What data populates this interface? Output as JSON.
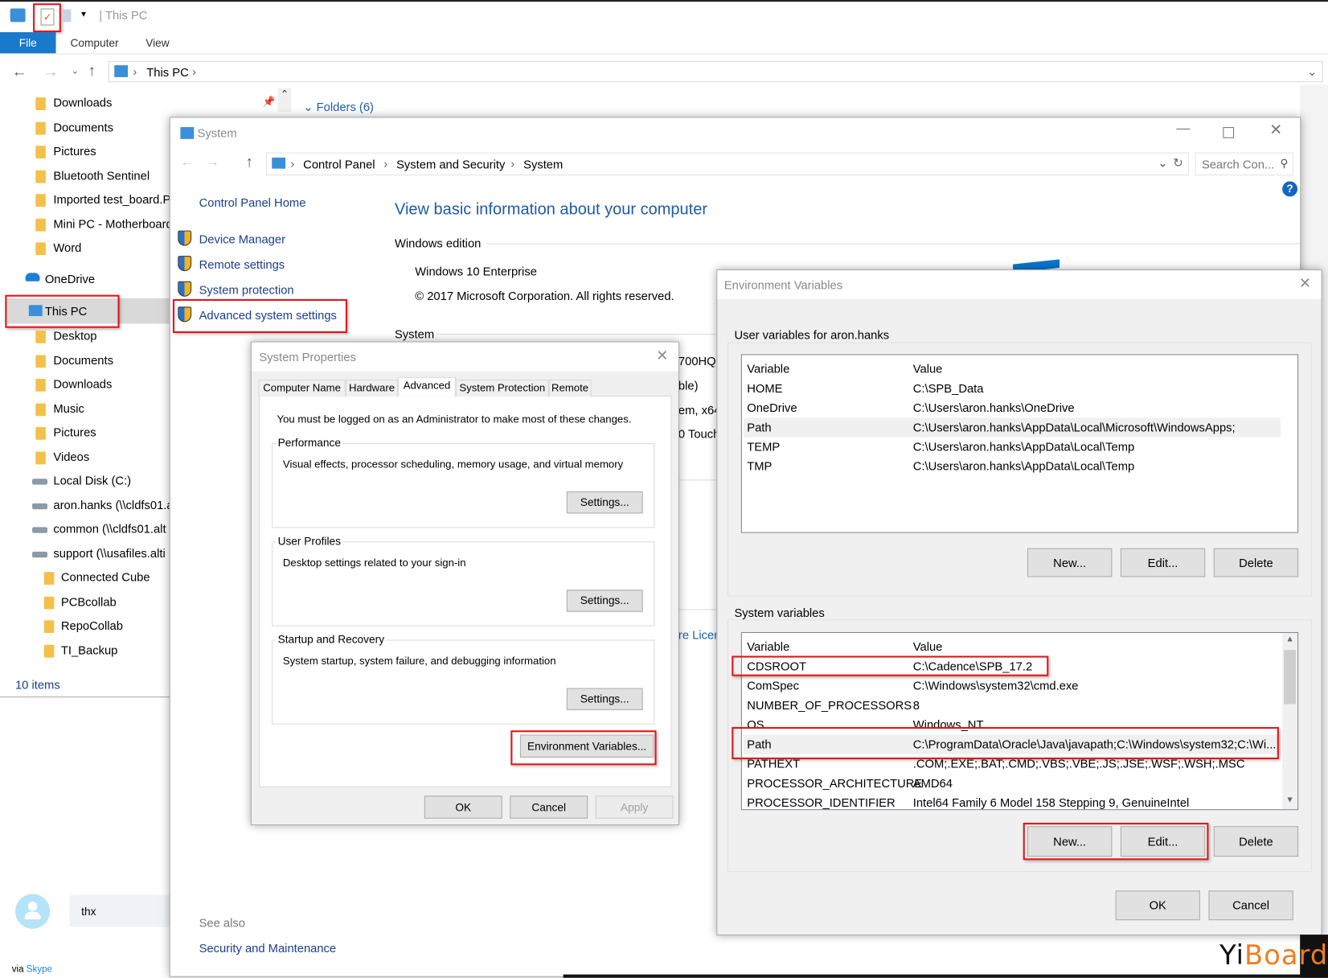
{
  "explorer": {
    "title": "This PC",
    "ribbon_tabs": [
      "File",
      "Computer",
      "View"
    ],
    "address": "This PC",
    "folders_header": "Folders (6)",
    "quick_access": [
      "Downloads",
      "Documents",
      "Pictures",
      "Bluetooth Sentinel",
      "Imported test_board.P",
      "Mini PC - Motherboard",
      "Word"
    ],
    "onedrive": "OneDrive",
    "this_pc": "This PC",
    "this_pc_items": [
      "Desktop",
      "Documents",
      "Downloads",
      "Music",
      "Pictures",
      "Videos",
      "Local Disk (C:)",
      "aron.hanks (\\\\cldfs01.a",
      "common (\\\\cldfs01.alt",
      "support (\\\\usafiles.alti"
    ],
    "network_folders": [
      "Connected Cube",
      "PCBcollab",
      "RepoCollab",
      "TI_Backup"
    ],
    "status": "10 items"
  },
  "system": {
    "title": "System",
    "breadcrumb": [
      "Control Panel",
      "System and Security",
      "System"
    ],
    "search_placeholder": "Search Con...",
    "home_link": "Control Panel Home",
    "links": [
      "Device Manager",
      "Remote settings",
      "System protection",
      "Advanced system settings"
    ],
    "heading": "View basic information about your computer",
    "windows_edition_label": "Windows edition",
    "edition": "Windows 10 Enterprise",
    "copyright": "© 2017 Microsoft Corporation. All rights reserved.",
    "system_label": "System",
    "partial_values": [
      "700HQ",
      "ble)",
      "em, x64",
      "0 Touch"
    ],
    "partial_link": "re Licen",
    "see_also": "See also",
    "security_link": "Security and Maintenance"
  },
  "system_properties": {
    "title": "System Properties",
    "tabs": [
      "Computer Name",
      "Hardware",
      "Advanced",
      "System Protection",
      "Remote"
    ],
    "active_tab": "Advanced",
    "admin_note": "You must be logged on as an Administrator to make most of these changes.",
    "groups": [
      {
        "label": "Performance",
        "desc": "Visual effects, processor scheduling, memory usage, and virtual memory",
        "button": "Settings..."
      },
      {
        "label": "User Profiles",
        "desc": "Desktop settings related to your sign-in",
        "button": "Settings..."
      },
      {
        "label": "Startup and Recovery",
        "desc": "System startup, system failure, and debugging information",
        "button": "Settings..."
      }
    ],
    "env_button": "Environment Variables...",
    "ok": "OK",
    "cancel": "Cancel",
    "apply": "Apply"
  },
  "env_vars": {
    "title": "Environment Variables",
    "user_label": "User variables for aron.hanks",
    "col_variable": "Variable",
    "col_value": "Value",
    "user_rows": [
      {
        "name": "HOME",
        "value": "C:\\SPB_Data"
      },
      {
        "name": "OneDrive",
        "value": "C:\\Users\\aron.hanks\\OneDrive"
      },
      {
        "name": "Path",
        "value": "C:\\Users\\aron.hanks\\AppData\\Local\\Microsoft\\WindowsApps;"
      },
      {
        "name": "TEMP",
        "value": "C:\\Users\\aron.hanks\\AppData\\Local\\Temp"
      },
      {
        "name": "TMP",
        "value": "C:\\Users\\aron.hanks\\AppData\\Local\\Temp"
      }
    ],
    "system_label": "System variables",
    "system_rows": [
      {
        "name": "CDSROOT",
        "value": "C:\\Cadence\\SPB_17.2"
      },
      {
        "name": "ComSpec",
        "value": "C:\\Windows\\system32\\cmd.exe"
      },
      {
        "name": "NUMBER_OF_PROCESSORS",
        "value": "8"
      },
      {
        "name": "OS",
        "value": "Windows_NT"
      },
      {
        "name": "Path",
        "value": "C:\\ProgramData\\Oracle\\Java\\javapath;C:\\Windows\\system32;C:\\Wi..."
      },
      {
        "name": "PATHEXT",
        "value": ".COM;.EXE;.BAT;.CMD;.VBS;.VBE;.JS;.JSE;.WSF;.WSH;.MSC"
      },
      {
        "name": "PROCESSOR_ARCHITECTURE",
        "value": "AMD64"
      },
      {
        "name": "PROCESSOR_IDENTIFIER",
        "value": "Intel64 Family 6 Model 158 Stepping 9, GenuineIntel"
      }
    ],
    "new": "New...",
    "edit": "Edit...",
    "delete": "Delete",
    "ok": "OK",
    "cancel": "Cancel"
  },
  "skype": {
    "message": "thx",
    "via": "via",
    "app": "Skype"
  },
  "watermark": "YiBoard",
  "colors": {
    "accent": "#1979ca",
    "highlight": "#e0161b",
    "link": "#1a3e8f",
    "heading": "#1e5aa8"
  }
}
